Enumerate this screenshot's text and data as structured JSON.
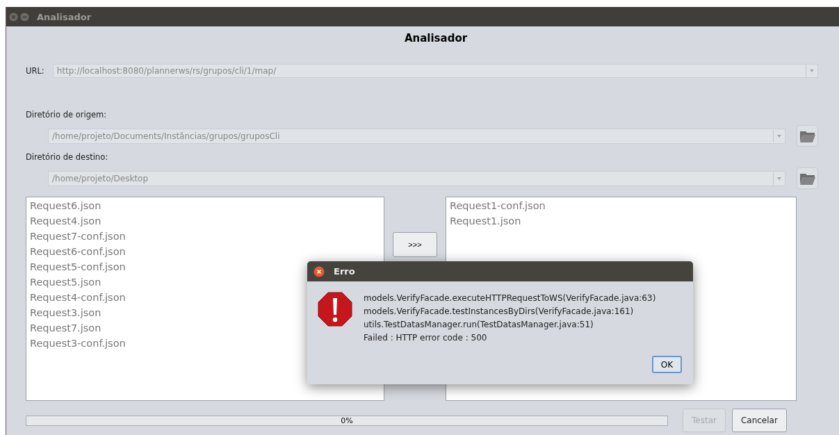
{
  "window": {
    "title": "Analisador"
  },
  "heading": "Analisador",
  "url": {
    "label": "URL:",
    "value": "http://localhost:8080/plannerws/rs/grupos/cli/1/map/"
  },
  "source_dir": {
    "label": "Diretório de origem:",
    "value": "/home/projeto/Documents/Instâncias/grupos/gruposCli"
  },
  "target_dir": {
    "label": "Diretório de destino:",
    "value": "/home/projeto/Desktop"
  },
  "left_list": [
    "Request6.json",
    "Request4.json",
    "Request7-conf.json",
    "Request6-conf.json",
    "Request5-conf.json",
    "Request5.json",
    "Request4-conf.json",
    "Request3.json",
    "Request7.json",
    "Request3-conf.json"
  ],
  "move_button": ">>>",
  "right_list": [
    "Request1-conf.json",
    "Request1.json"
  ],
  "progress": {
    "level": 0,
    "reading": "0%"
  },
  "buttons": [
    {
      "label": "Testar",
      "disabled": true
    },
    {
      "label": "Cancelar",
      "disabled": false
    }
  ],
  "dialog": {
    "title": "Erro",
    "lines": [
      "models.VerifyFacade.executeHTTPRequestToWS(VerifyFacade.java:63)",
      "models.VerifyFacade.testInstancesByDirs(VerifyFacade.java:161)",
      "utils.TestDatasManager.run(TestDatasManager.java:51)",
      "Failed : HTTP error code : 500"
    ],
    "button": "OK"
  }
}
